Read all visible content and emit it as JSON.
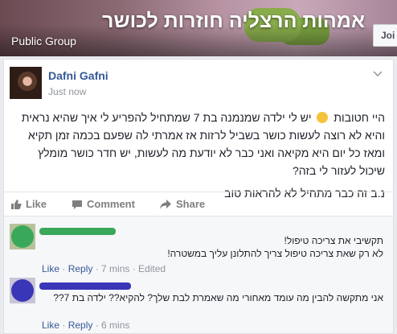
{
  "group": {
    "title": "אמהות הרצליה חוזרות לכושר",
    "privacy": "Public Group",
    "join_label": "Joi"
  },
  "post": {
    "author": "Dafni Gafni",
    "timestamp": "Just now",
    "body_part1": "היי חטובות",
    "body_part2": "יש לי ילדה שמנמנה בת 7 שמתחיל להפריע לי איך שהיא נראית והיא לא רוצה לעשות כושר בשביל לרזות אז אמרתי לה שפעם בכמה זמן תקיא ומאז כל יום היא מקיאה ואני כבר לא יודעת מה לעשות, יש חדר כושר מומלץ שיכול לעזור לי בזה?",
    "body_ps": "נ.ב זה כבר מתחיל לא להראות טוב",
    "actions": {
      "like": "Like",
      "comment": "Comment",
      "share": "Share"
    }
  },
  "comments": [
    {
      "line1": "תקשיבי את צריכה טיפול!",
      "line2": "לא רק שאת צריכה טיפול צריך להתלונן עליך במשטרה!",
      "like": "Like",
      "sep1": " · ",
      "reply": "Reply",
      "meta": " · 7 mins · Edited",
      "avatar_color": "#3aa85a",
      "name_color": "#3aa85a"
    },
    {
      "line1": "אני מתקשה להבין מה עומד מאחורי מה שאמרת לבת שלך? להקיא?? ילדה בת 7??",
      "like": "Like",
      "sep1": " · ",
      "reply": "Reply",
      "meta": " · 6 mins",
      "avatar_color": "#3a36b8",
      "name_color": "#3a36b8"
    }
  ],
  "colors": {
    "link": "#365899",
    "muted": "#90949c"
  }
}
